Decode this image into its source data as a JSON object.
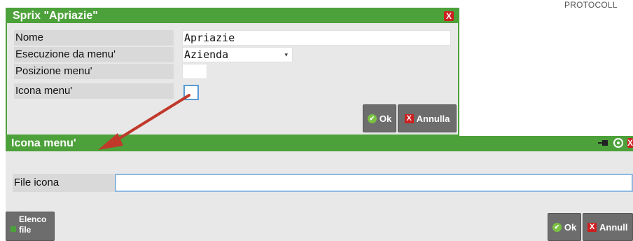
{
  "top_right_text": "PROTOCOLL",
  "dialog1": {
    "title": "Sprix \"Apriazie\"",
    "rows": [
      {
        "label": "Nome",
        "value": "Apriazie"
      },
      {
        "label": "Esecuzione da menu'",
        "value": "Azienda",
        "arrow": "▾"
      },
      {
        "label": "Posizione menu'",
        "value": ""
      },
      {
        "label": "Icona menu'",
        "value": ""
      }
    ],
    "ok_label": "Ok",
    "cancel_label": "Annulla",
    "close_glyph": "X"
  },
  "dialog2": {
    "title": "Icona menu'",
    "file_label": "File icona",
    "file_value": "",
    "elenco_label_1": "Elenco",
    "elenco_label_2": "file",
    "ok_label": "Ok",
    "cancel_label": "Annull",
    "close_glyph": "X"
  },
  "colors": {
    "titlebar": "#4ca13a",
    "arrow": "#c0392b"
  }
}
